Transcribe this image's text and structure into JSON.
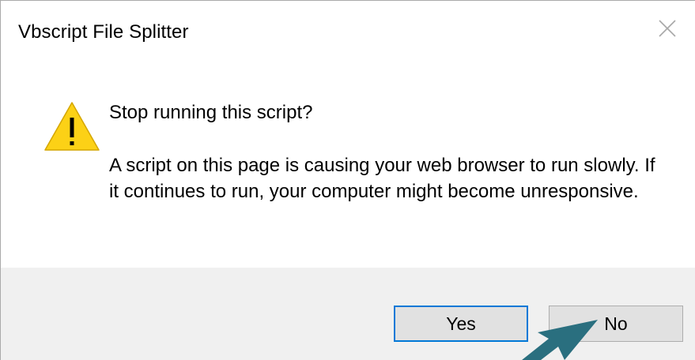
{
  "window": {
    "title": "Vbscript File Splitter"
  },
  "message": {
    "main": "Stop running this script?",
    "description": "A script on this page is causing your web browser to run slowly. If it continues to run, your computer might become unresponsive."
  },
  "buttons": {
    "yes_label": "Yes",
    "no_label": "No",
    "default": "yes"
  },
  "icons": {
    "warning": "warning-icon",
    "close": "close-icon",
    "annotation": "annotation-arrow"
  },
  "colors": {
    "accent": "#0078d7",
    "warning_fill": "#fcd116",
    "annotation_arrow": "#2a6f7f",
    "button_bar": "#f0f0f0"
  }
}
